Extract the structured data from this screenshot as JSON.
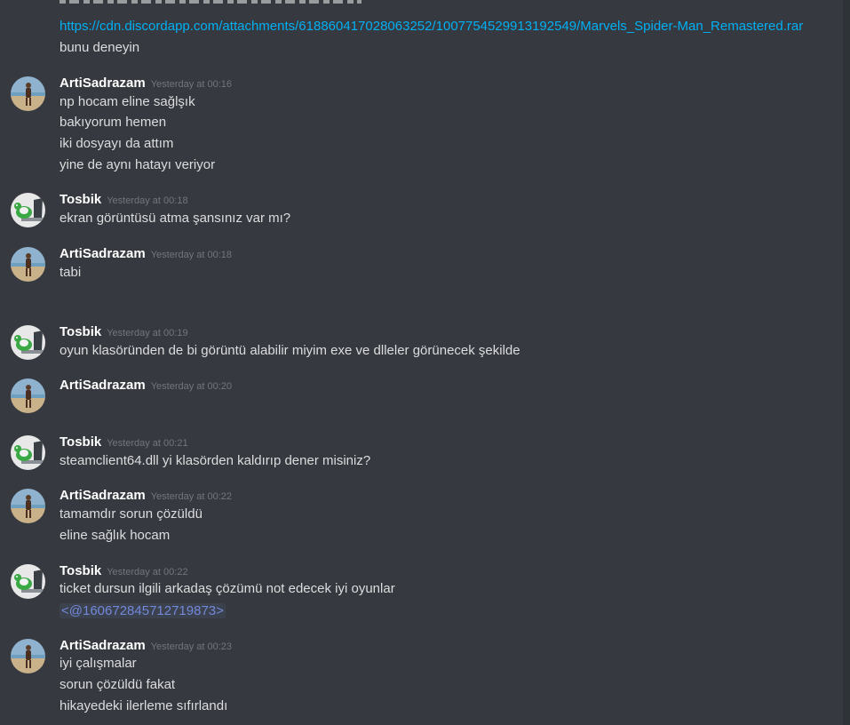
{
  "colors": {
    "background": "#36393f",
    "author": "#ffffff",
    "timestamp": "#72767d",
    "text": "#dcddde",
    "link": "#00b0f4",
    "mention": "#7289da"
  },
  "top_fragment": {
    "link": "https://cdn.discordapp.com/attachments/618860417028063252/1007754529913192549/Marvels_Spider-Man_Remastered.rar",
    "text": "bunu deneyin"
  },
  "messages": [
    {
      "author": "ArtiSadrazam",
      "timestamp": "Yesterday at 00:16",
      "avatar": "beach-person-avatar",
      "lines": [
        "np hocam eline sağlşık",
        "bakıyorum hemen",
        "iki dosyayı da attım",
        "yine de aynı hatayı veriyor"
      ]
    },
    {
      "author": "Tosbik",
      "timestamp": "Yesterday at 00:18",
      "avatar": "turtle-laptop-avatar",
      "lines": [
        "ekran görüntüsü atma şansınız var mı?"
      ]
    },
    {
      "author": "ArtiSadrazam",
      "timestamp": "Yesterday at 00:18",
      "avatar": "beach-person-avatar",
      "lines": [
        "tabi"
      ]
    },
    {
      "author": "Tosbik",
      "timestamp": "Yesterday at 00:19",
      "avatar": "turtle-laptop-avatar",
      "lines": [
        "oyun klasöründen de bi görüntü alabilir miyim exe ve dlleler görünecek şekilde"
      ]
    },
    {
      "author": "ArtiSadrazam",
      "timestamp": "Yesterday at 00:20",
      "avatar": "beach-person-avatar",
      "lines": []
    },
    {
      "author": "Tosbik",
      "timestamp": "Yesterday at 00:21",
      "avatar": "turtle-laptop-avatar",
      "lines": [
        "steamclient64.dll yi klasörden kaldırıp dener misiniz?"
      ]
    },
    {
      "author": "ArtiSadrazam",
      "timestamp": "Yesterday at 00:22",
      "avatar": "beach-person-avatar",
      "lines": [
        "tamamdır sorun çözüldü",
        "eline sağlık hocam"
      ]
    },
    {
      "author": "Tosbik",
      "timestamp": "Yesterday at 00:22",
      "avatar": "turtle-laptop-avatar",
      "lines": [
        "ticket dursun ilgili arkadaş çözümü not edecek iyi oyunlar"
      ],
      "mention": "<@160672845712719873>"
    },
    {
      "author": "ArtiSadrazam",
      "timestamp": "Yesterday at 00:23",
      "avatar": "beach-person-avatar",
      "lines": [
        "iyi çalışmalar",
        "sorun çözüldü fakat",
        "hikayedeki ilerleme sıfırlandı"
      ]
    }
  ]
}
